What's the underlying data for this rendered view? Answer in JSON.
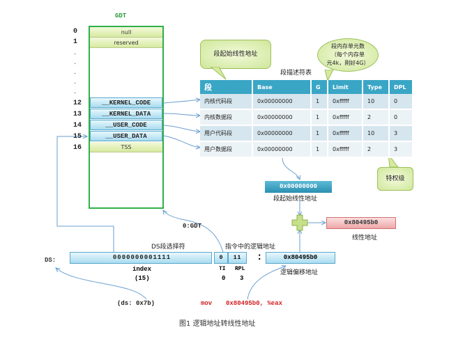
{
  "gdt": {
    "title": "GDT",
    "rows": [
      {
        "index": "0",
        "label": "null"
      },
      {
        "index": "1",
        "label": "reserved"
      },
      {
        "index": "12",
        "label": "__KERNEL_CODE"
      },
      {
        "index": "13",
        "label": "__KERNEL_DATA"
      },
      {
        "index": "14",
        "label": "__USER_CODE"
      },
      {
        "index": "15",
        "label": "__USER_DATA"
      },
      {
        "index": "16",
        "label": "TSS"
      }
    ],
    "ellipsis": "."
  },
  "callouts": {
    "base_note": "段起始线性地址",
    "limit_note": [
      "段内存单元数",
      "（每个内存单",
      "元4k，刚好4G）"
    ],
    "dpl_note": "特权级"
  },
  "descriptor_table": {
    "title": "段描述符表",
    "headers": [
      "段",
      "Base",
      "G",
      "Limit",
      "Type",
      "DPL"
    ],
    "rows": [
      [
        "内核代码段",
        "0x00000000",
        "1",
        "0xfffff",
        "10",
        "0"
      ],
      [
        "内核数据段",
        "0x00000000",
        "1",
        "0xfffff",
        "2",
        "0"
      ],
      [
        "用户代码段",
        "0x00000000",
        "1",
        "0xfffff",
        "10",
        "3"
      ],
      [
        "用户数据段",
        "0x00000000",
        "1",
        "0xfffff",
        "2",
        "3"
      ]
    ]
  },
  "segment_base": {
    "value": "0x00000000",
    "caption": "段起始线性地址"
  },
  "linear_address": {
    "value": "0x80495b0",
    "caption": "线性地址"
  },
  "selector": {
    "register": "DS:",
    "caption": "DS段选择符",
    "index_bits": "0000000001111",
    "ti_bit": "0",
    "rpl_bits": "11",
    "index_label": "index",
    "index_value": "(15)",
    "ti_label": "TI",
    "ti_value": "0",
    "rpl_label": "RPL",
    "rpl_value": "3",
    "ti_note": "0:GDT",
    "ds_value": "(ds: 0x7b)"
  },
  "logical": {
    "caption": "指令中的逻辑地址",
    "separator": ":",
    "offset_value": "0x80495b0",
    "offset_caption": "逻辑偏移地址"
  },
  "instruction": {
    "mnemonic": "mov",
    "operands": "0x80495b0, %eax"
  },
  "figure_caption": "图1 逻辑地址转线性地址",
  "colors": {
    "gdt_border": "#2fb04a",
    "table_header": "#3aa6c6",
    "linear_box": "#f4b8b8",
    "instruction": "#d02020",
    "arrow": "#6a9ed0"
  }
}
